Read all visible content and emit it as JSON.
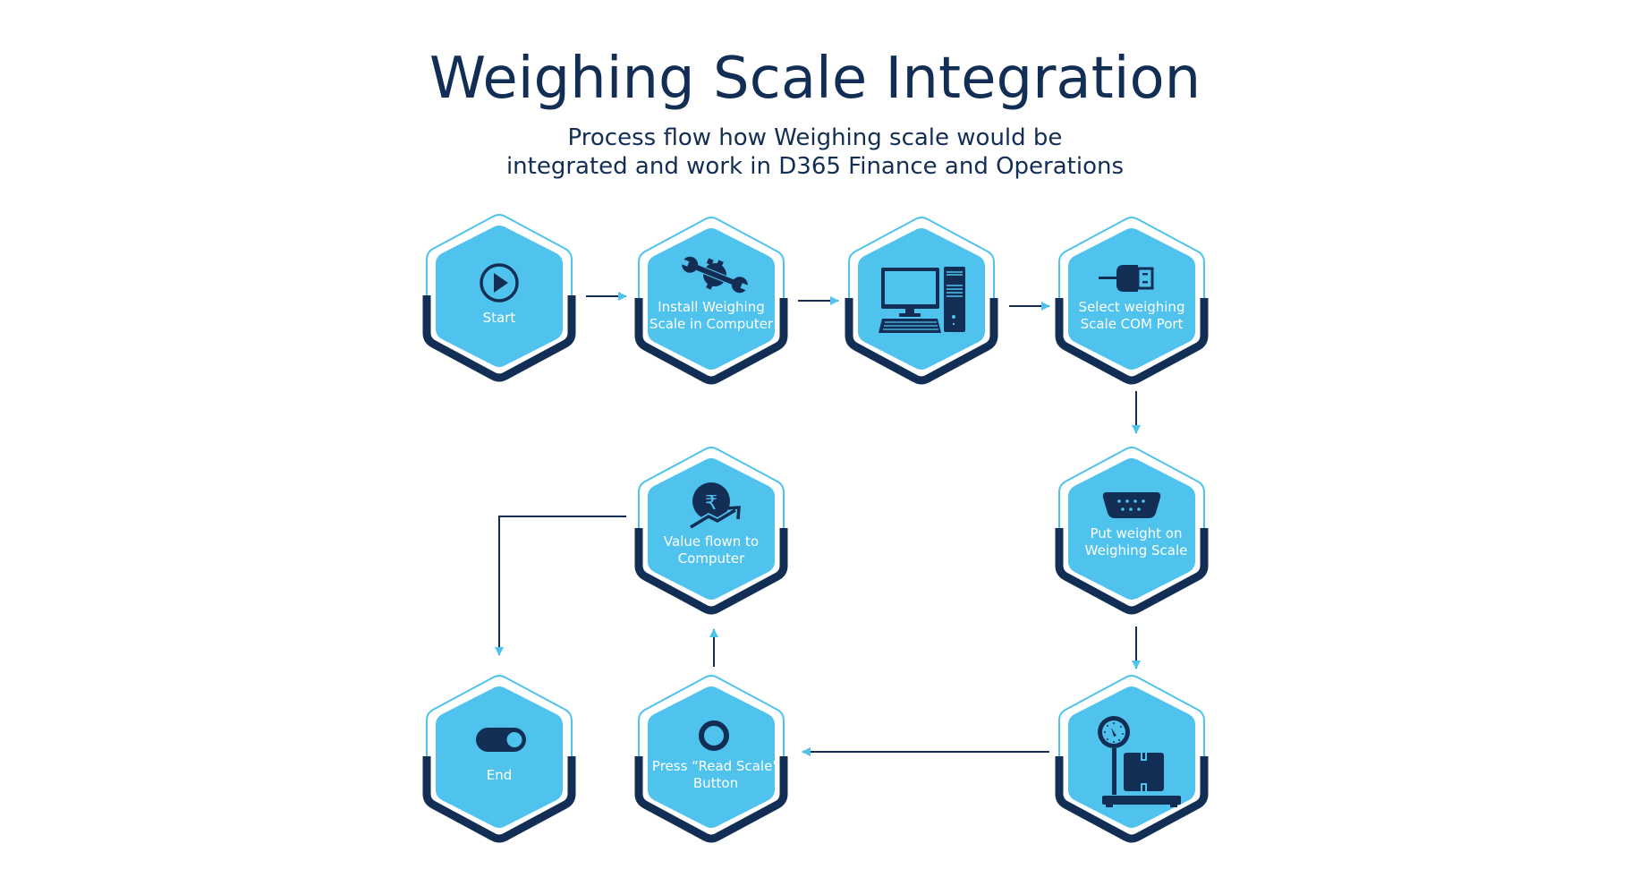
{
  "header": {
    "title": "Weighing Scale Integration",
    "subtitle_line1": "Process flow how Weighing scale would be",
    "subtitle_line2": "integrated and work in D365 Finance and Operations"
  },
  "colors": {
    "navy": "#132e54",
    "sky": "#4fc3ee",
    "arrow_head": "#4fc3ee",
    "background": "#ffffff"
  },
  "nodes": [
    {
      "id": "start",
      "label": "Start",
      "icon": "play-circle-icon",
      "step": 1
    },
    {
      "id": "install",
      "label": "Install Weighing Scale in Computer",
      "icon": "wrench-gear-icon",
      "step": 2
    },
    {
      "id": "computer",
      "label": "",
      "icon": "desktop-computer-icon",
      "step": 3
    },
    {
      "id": "com-port",
      "label": "Select weighing Scale COM Port",
      "icon": "usb-plug-icon",
      "step": 4
    },
    {
      "id": "put-weight",
      "label": "Put weight on Weighing Scale",
      "icon": "serial-port-icon",
      "step": 5
    },
    {
      "id": "scale",
      "label": "",
      "icon": "weighing-scale-icon",
      "step": 6
    },
    {
      "id": "read-scale",
      "label": "Press “Read Scale” Button",
      "icon": "ring-button-icon",
      "step": 7
    },
    {
      "id": "value-flown",
      "label": "Value flown to Computer",
      "icon": "rupee-growth-icon",
      "step": 8
    },
    {
      "id": "end",
      "label": "End",
      "icon": "toggle-switch-icon",
      "step": 9
    }
  ],
  "edges": [
    {
      "from": "start",
      "to": "install"
    },
    {
      "from": "install",
      "to": "computer"
    },
    {
      "from": "computer",
      "to": "com-port"
    },
    {
      "from": "com-port",
      "to": "put-weight"
    },
    {
      "from": "put-weight",
      "to": "scale"
    },
    {
      "from": "scale",
      "to": "read-scale"
    },
    {
      "from": "read-scale",
      "to": "value-flown"
    },
    {
      "from": "value-flown",
      "to": "end"
    }
  ]
}
